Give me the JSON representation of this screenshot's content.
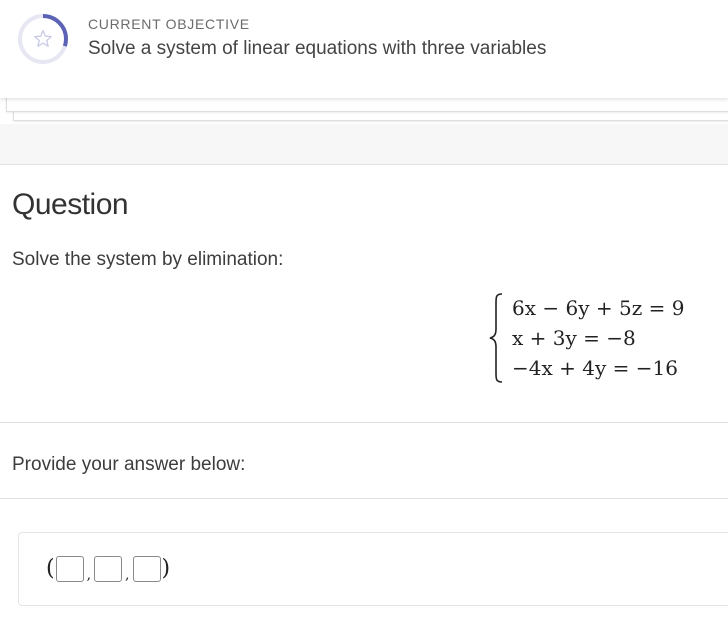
{
  "objective": {
    "label": "CURRENT OBJECTIVE",
    "title": "Solve a system of linear equations with three variables",
    "icon": "star-icon",
    "progress": 0.3,
    "ring_color": "#5c62b5",
    "ring_track_color": "#e6e7f3"
  },
  "question": {
    "heading": "Question",
    "prompt": "Solve the system by elimination:",
    "equations": [
      "6x − 6y + 5z = 9",
      "x + 3y = −8",
      "−4x + 4y = −16"
    ]
  },
  "answer": {
    "prompt": "Provide your answer below:",
    "open_paren": "(",
    "close_paren": ")",
    "separator": ",",
    "fields": [
      {
        "value": "",
        "placeholder": ""
      },
      {
        "value": "",
        "placeholder": ""
      },
      {
        "value": "",
        "placeholder": ""
      }
    ]
  }
}
